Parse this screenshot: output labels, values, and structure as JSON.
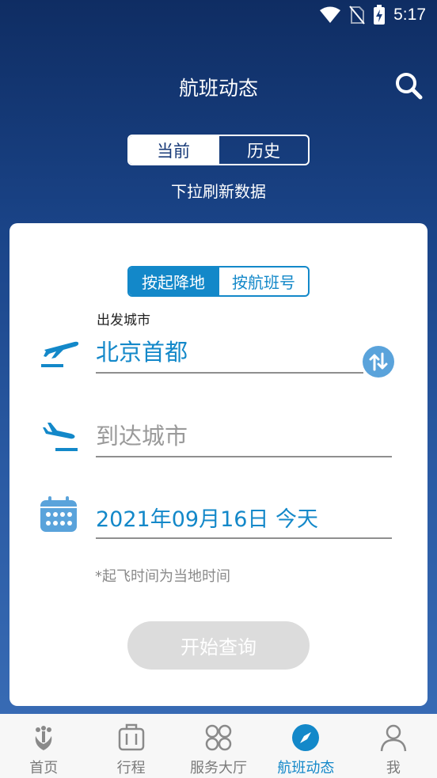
{
  "status": {
    "time": "5:17"
  },
  "header": {
    "title": "航班动态"
  },
  "top_tabs": {
    "current": "当前",
    "history": "历史"
  },
  "pull_hint": "下拉刷新数据",
  "search_mode": {
    "by_city": "按起降地",
    "by_flight": "按航班号"
  },
  "form": {
    "departure_label": "出发城市",
    "departure_value": "北京首都",
    "arrival_placeholder": "到达城市",
    "date_value": "2021年09月16日 今天",
    "note": "*起飞时间为当地时间",
    "query_button": "开始查询"
  },
  "tabbar": [
    {
      "label": "首页",
      "icon": "home-logo-icon"
    },
    {
      "label": "行程",
      "icon": "luggage-icon"
    },
    {
      "label": "服务大厅",
      "icon": "services-icon"
    },
    {
      "label": "航班动态",
      "icon": "compass-icon",
      "active": true
    },
    {
      "label": "我",
      "icon": "person-icon"
    }
  ],
  "colors": {
    "accent": "#1388c9",
    "header_bg": "#1a4488",
    "disabled": "#dcdcdc"
  }
}
